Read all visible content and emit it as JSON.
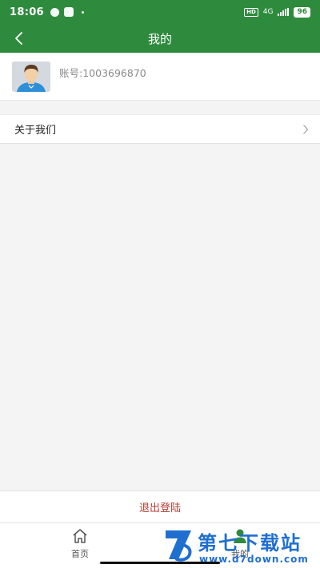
{
  "status_bar": {
    "time": "18:06",
    "network": "4G",
    "battery": "96",
    "hd": "HD"
  },
  "nav": {
    "title": "我的"
  },
  "profile": {
    "account": "账号:1003696870"
  },
  "menu": {
    "about_label": "关于我们"
  },
  "logout": {
    "label": "退出登陆"
  },
  "tabbar": {
    "home_label": "首页",
    "mine_label": "我的"
  },
  "watermark": {
    "title": "第七下载站",
    "url": "www.d7down.com"
  },
  "colors": {
    "primary_green": "#2e8b3e",
    "logout_red": "#b33b32",
    "watermark_blue": "#1f6fd1"
  },
  "icons": {
    "back": "chevron-left-icon",
    "menu_arrow": "chevron-right-icon",
    "home": "home-icon",
    "mine": "user-icon"
  }
}
